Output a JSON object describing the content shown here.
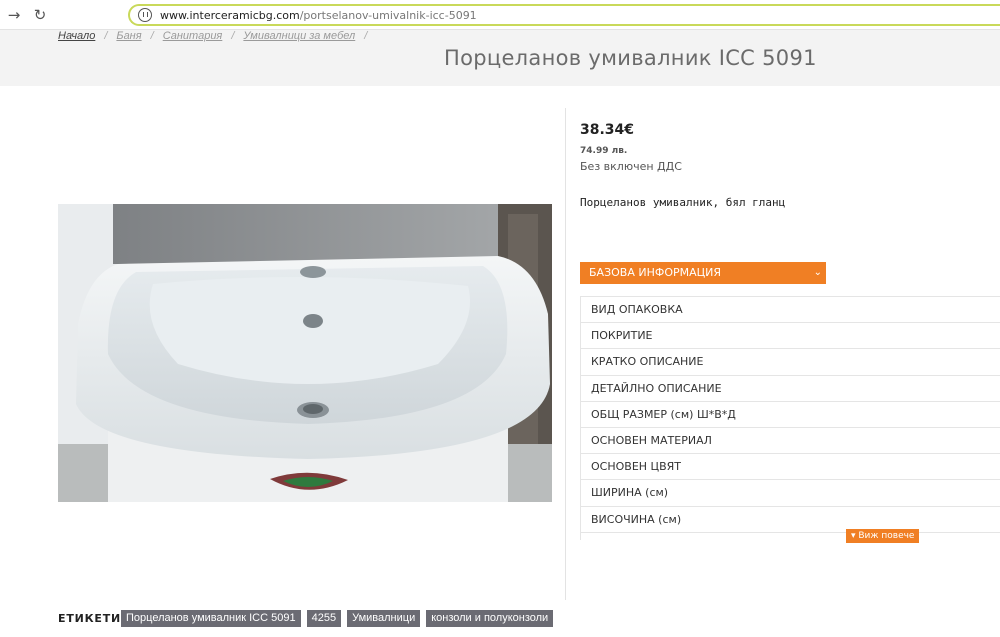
{
  "browser": {
    "url_domain": "www.interceramicbg.com",
    "url_path": "/portselanov-umivalnik-icc-5091"
  },
  "breadcrumb": [
    "Начало",
    "Баня",
    "Санитария",
    "Умивалници за мебел",
    ""
  ],
  "product": {
    "title": "Порцеланов умивалник ICC 5091",
    "price": "38.34€",
    "price_bgn": "74.99 лв.",
    "vat_note": "Без включен ДДС",
    "short_description": "Порцеланов умивалник, бял гланц"
  },
  "specs": {
    "section_title": "БАЗОВА ИНФОРМАЦИЯ",
    "rows": [
      "ВИД ОПАКОВКА",
      "ПОКРИТИЕ",
      "КРАТКО ОПИСАНИЕ",
      "ДЕТАЙЛНО ОПИСАНИЕ",
      "ОБЩ РАЗМЕР (см) Ш*В*Д",
      "ОСНОВЕН МАТЕРИАЛ",
      "ОСНОВЕН ЦВЯТ",
      "ШИРИНА (см)",
      "ВИСОЧИНА (см)"
    ],
    "more_label": "▾ Виж повече"
  },
  "tags": {
    "label": "ЕТИКЕТИ:",
    "items": [
      "Порцеланов умивалник ICC 5091",
      "4255",
      "Умивалници",
      "конзоли и полуконзоли"
    ]
  },
  "colors": {
    "accent": "#f07f24",
    "tag_bg": "#6b6b73"
  }
}
